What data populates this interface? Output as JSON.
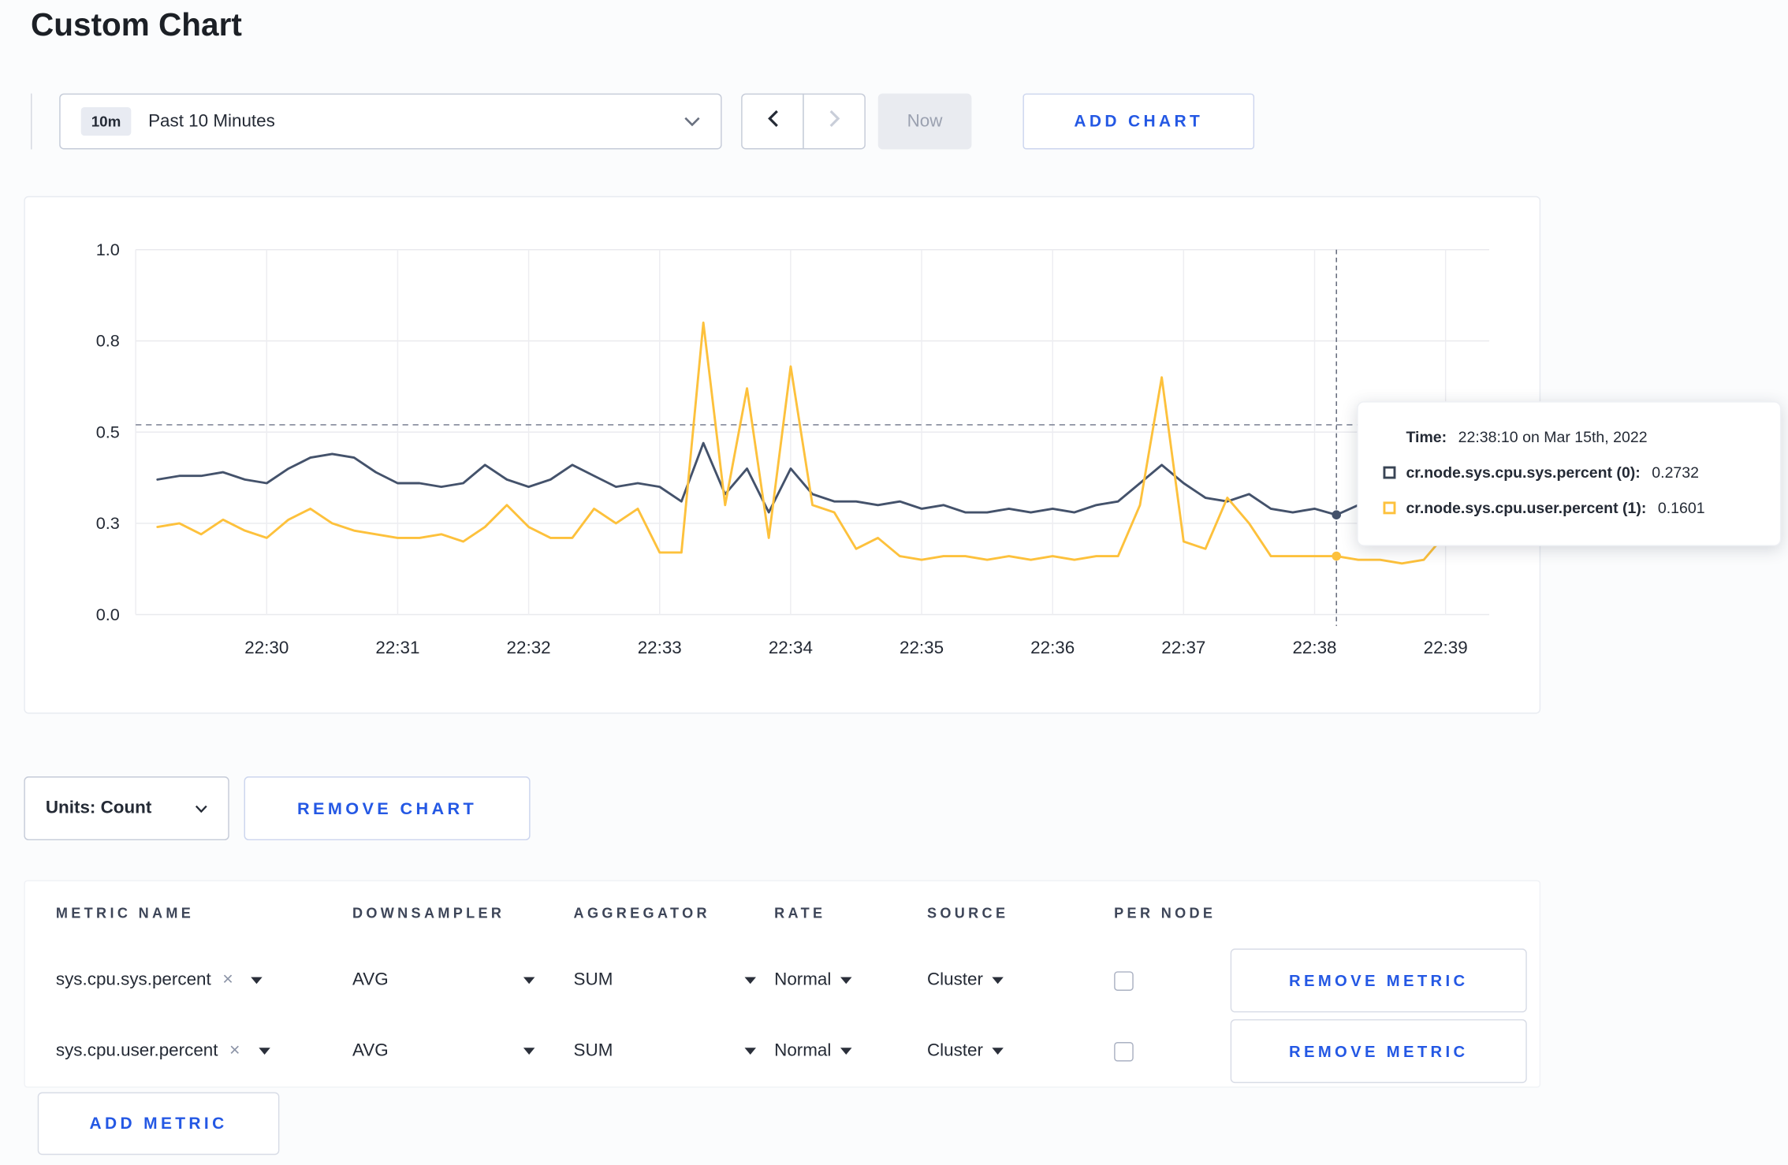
{
  "page": {
    "title": "Custom Chart"
  },
  "colors": {
    "accent": "#2458e4",
    "series_sys": "#44526b",
    "series_user": "#fdc13c",
    "grid": "#e9eaee",
    "crosshair": "#5c6375"
  },
  "icons": {
    "clear": "×"
  },
  "toolbar": {
    "time_badge": "10m",
    "time_label": "Past 10 Minutes",
    "now_label": "Now",
    "add_chart_label": "ADD CHART"
  },
  "chart_data": {
    "type": "line",
    "title": "",
    "xlabel": "",
    "ylabel": "",
    "ylim": [
      0,
      1
    ],
    "grid": true,
    "legend_position": "tooltip",
    "y_tick_values": [
      1,
      0.75,
      0.5,
      0.25,
      0
    ],
    "y_tick_labels": [
      "1.0",
      "0.8",
      "0.5",
      "0.3",
      "0.0"
    ],
    "x_ticks": [
      "22:30",
      "22:31",
      "22:32",
      "22:33",
      "22:34",
      "22:35",
      "22:36",
      "22:37",
      "22:38",
      "22:39"
    ],
    "x_domain_seconds": [
      -60,
      560
    ],
    "first_sample_offset_seconds": -50,
    "sample_interval_seconds": 10,
    "series": [
      {
        "name": "cr.node.sys.cpu.sys.percent",
        "color": "#44526b",
        "values": [
          0.37,
          0.38,
          0.38,
          0.39,
          0.37,
          0.36,
          0.4,
          0.43,
          0.44,
          0.43,
          0.39,
          0.36,
          0.36,
          0.35,
          0.36,
          0.41,
          0.37,
          0.35,
          0.37,
          0.41,
          0.38,
          0.35,
          0.36,
          0.35,
          0.31,
          0.47,
          0.33,
          0.4,
          0.28,
          0.4,
          0.33,
          0.31,
          0.31,
          0.3,
          0.31,
          0.29,
          0.3,
          0.28,
          0.28,
          0.29,
          0.28,
          0.29,
          0.28,
          0.3,
          0.31,
          0.36,
          0.41,
          0.36,
          0.32,
          0.31,
          0.33,
          0.29,
          0.28,
          0.29,
          0.2732,
          0.3,
          0.3,
          0.31,
          0.3,
          0.3,
          0.31
        ]
      },
      {
        "name": "cr.node.sys.cpu.user.percent",
        "color": "#fdc13c",
        "values": [
          0.24,
          0.25,
          0.22,
          0.26,
          0.23,
          0.21,
          0.26,
          0.29,
          0.25,
          0.23,
          0.22,
          0.21,
          0.21,
          0.22,
          0.2,
          0.24,
          0.3,
          0.24,
          0.21,
          0.21,
          0.29,
          0.25,
          0.29,
          0.17,
          0.17,
          0.8,
          0.3,
          0.62,
          0.21,
          0.68,
          0.3,
          0.28,
          0.18,
          0.21,
          0.16,
          0.15,
          0.16,
          0.16,
          0.15,
          0.16,
          0.15,
          0.16,
          0.15,
          0.16,
          0.16,
          0.3,
          0.65,
          0.2,
          0.18,
          0.32,
          0.25,
          0.16,
          0.16,
          0.16,
          0.1601,
          0.15,
          0.15,
          0.14,
          0.15,
          0.22,
          0.27
        ]
      }
    ],
    "crosshair": {
      "x_offset_seconds": 490,
      "hline_value": 0.52
    }
  },
  "tooltip": {
    "time_label": "Time:",
    "time_value": "22:38:10 on Mar 15th, 2022",
    "entries": [
      {
        "label": "cr.node.sys.cpu.sys.percent (0):",
        "value": "0.2732",
        "color": "#394455"
      },
      {
        "label": "cr.node.sys.cpu.user.percent (1):",
        "value": "0.1601",
        "color": "#fdc13c"
      }
    ]
  },
  "chart_controls": {
    "units_label": "Units: Count",
    "remove_chart_label": "REMOVE CHART"
  },
  "metrics_table": {
    "headers": [
      "METRIC NAME",
      "DOWNSAMPLER",
      "AGGREGATOR",
      "RATE",
      "SOURCE",
      "PER NODE"
    ],
    "rows": [
      {
        "metric": "sys.cpu.sys.percent",
        "downsampler": "AVG",
        "aggregator": "SUM",
        "rate": "Normal",
        "source": "Cluster",
        "per_node": false,
        "remove_label": "REMOVE METRIC"
      },
      {
        "metric": "sys.cpu.user.percent",
        "downsampler": "AVG",
        "aggregator": "SUM",
        "rate": "Normal",
        "source": "Cluster",
        "per_node": false,
        "remove_label": "REMOVE METRIC"
      }
    ],
    "add_metric_label": "ADD METRIC"
  }
}
